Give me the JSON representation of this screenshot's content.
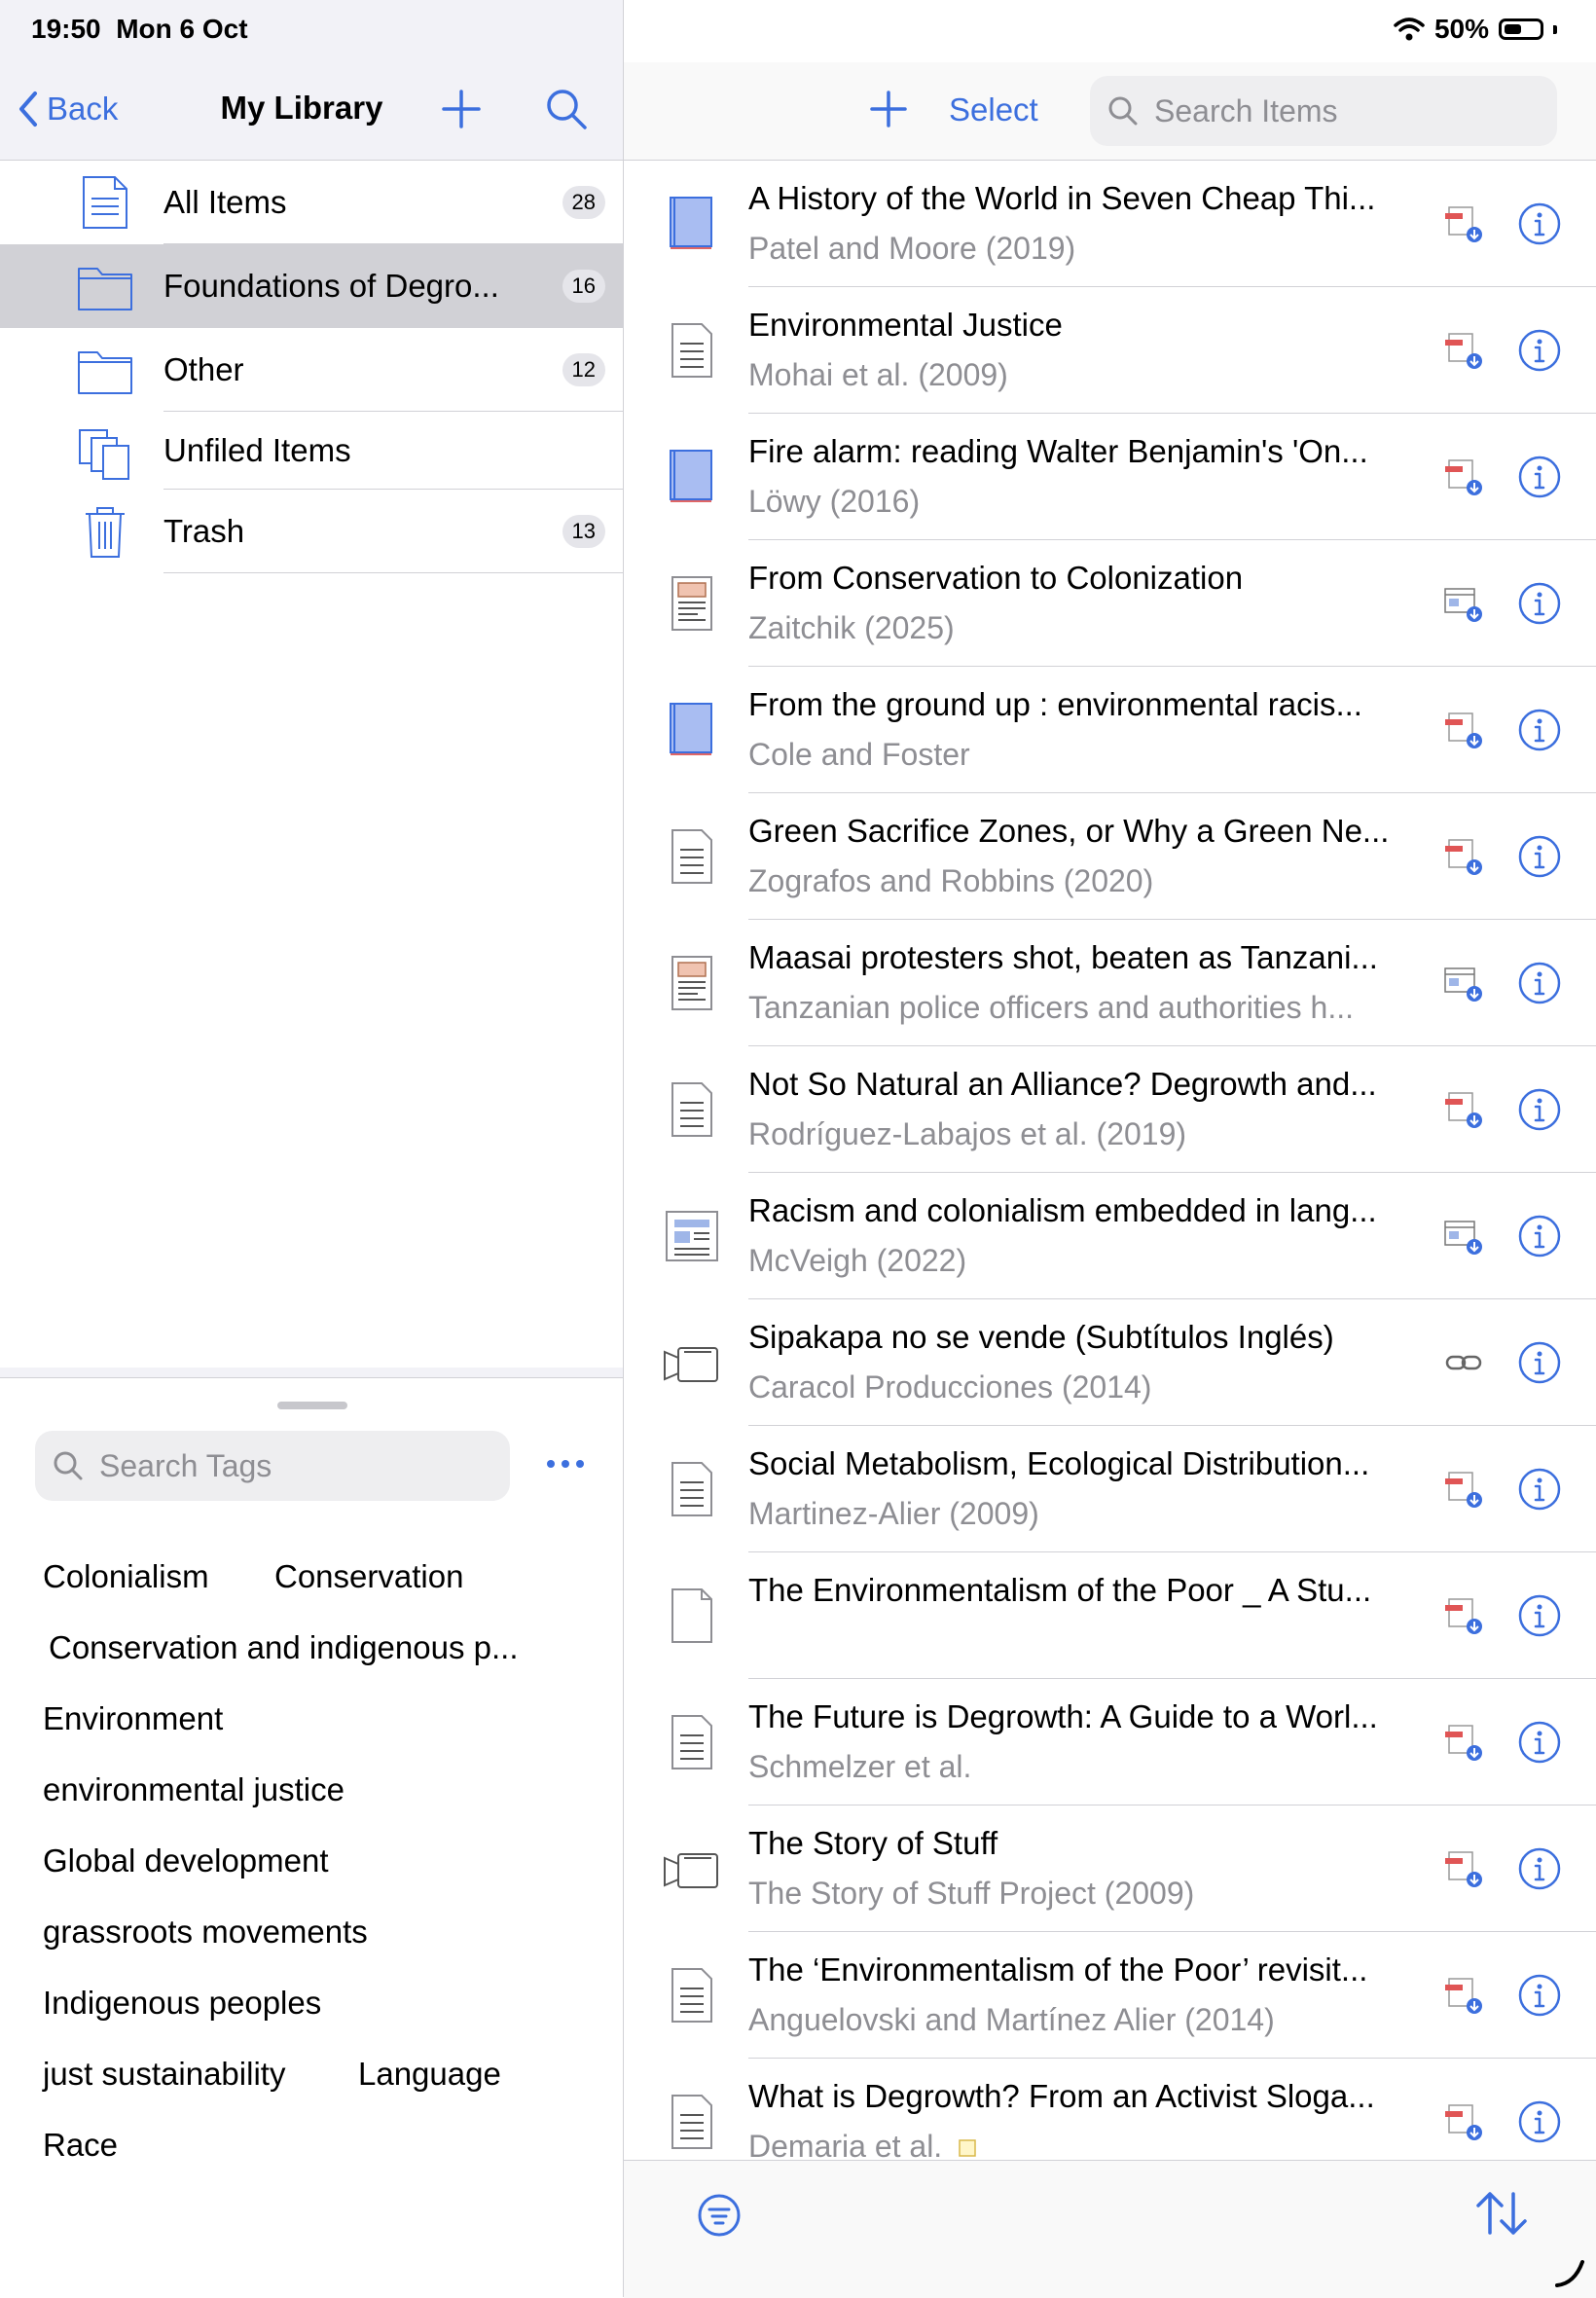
{
  "status": {
    "time": "19:50",
    "date": "Mon 6 Oct",
    "battery": "50%",
    "battery_level": 0.5
  },
  "left_header": {
    "back_label": "Back",
    "title": "My Library"
  },
  "collections": [
    {
      "label": "All Items",
      "count": "28",
      "icon": "document-icon"
    },
    {
      "label": "Foundations of Degro...",
      "count": "16",
      "icon": "folder-icon",
      "selected": true
    },
    {
      "label": "Other",
      "count": "12",
      "icon": "folder-icon"
    },
    {
      "label": "Unfiled Items",
      "count": "",
      "icon": "unfiled-icon"
    },
    {
      "label": "Trash",
      "count": "13",
      "icon": "trash-icon"
    }
  ],
  "tags": {
    "search_placeholder": "Search Tags",
    "items": [
      "Colonialism",
      "Conservation",
      "Conservation and indigenous p...",
      "Environment",
      "environmental justice",
      "Global development",
      "grassroots movements",
      "Indigenous peoples",
      "just sustainability",
      "Language",
      "Race"
    ]
  },
  "right_header": {
    "select_label": "Select",
    "search_placeholder": "Search Items"
  },
  "items": [
    {
      "title": "A History of the World in Seven Cheap Thi...",
      "subtitle": "Patel and Moore (2019)",
      "type": "book",
      "attachment": "pdf"
    },
    {
      "title": "Environmental Justice",
      "subtitle": "Mohai et al. (2009)",
      "type": "article",
      "attachment": "pdf"
    },
    {
      "title": "Fire alarm: reading Walter Benjamin's 'On...",
      "subtitle": "Löwy (2016)",
      "type": "book",
      "attachment": "pdf"
    },
    {
      "title": "From Conservation to Colonization",
      "subtitle": "Zaitchik (2025)",
      "type": "magazine",
      "attachment": "snapshot"
    },
    {
      "title": "From the ground up : environmental racis...",
      "subtitle": "Cole and Foster",
      "type": "book",
      "attachment": "pdf"
    },
    {
      "title": "Green Sacrifice Zones, or Why a Green Ne...",
      "subtitle": "Zografos and Robbins (2020)",
      "type": "article",
      "attachment": "pdf"
    },
    {
      "title": "Maasai protesters shot, beaten as Tanzani...",
      "subtitle": "Tanzanian police officers and authorities h...",
      "type": "magazine",
      "attachment": "snapshot"
    },
    {
      "title": "Not So Natural an Alliance? Degrowth and...",
      "subtitle": "Rodríguez-Labajos et al. (2019)",
      "type": "article",
      "attachment": "pdf"
    },
    {
      "title": "Racism and colonialism embedded in lang...",
      "subtitle": "McVeigh (2022)",
      "type": "newspaper",
      "attachment": "snapshot"
    },
    {
      "title": "Sipakapa no se vende (Subtítulos Inglés)",
      "subtitle": "Caracol Producciones (2014)",
      "type": "video",
      "attachment": "link"
    },
    {
      "title": "Social Metabolism, Ecological Distribution...",
      "subtitle": "Martinez-Alier (2009)",
      "type": "article",
      "attachment": "pdf"
    },
    {
      "title": "The Environmentalism of the Poor _ A Stu...",
      "subtitle": "",
      "type": "blank",
      "attachment": "pdf"
    },
    {
      "title": "The Future is Degrowth: A Guide to a Worl...",
      "subtitle": "Schmelzer et al.",
      "type": "article",
      "attachment": "pdf"
    },
    {
      "title": "The Story of Stuff",
      "subtitle": "The Story of Stuff Project (2009)",
      "type": "video",
      "attachment": "pdf"
    },
    {
      "title": "The ‘Environmentalism of the Poor’ revisit...",
      "subtitle": "Anguelovski and Martínez Alier (2014)",
      "type": "article",
      "attachment": "pdf"
    },
    {
      "title": "What is Degrowth? From an Activist Sloga...",
      "subtitle": "Demaria et al.",
      "type": "article",
      "attachment": "pdf",
      "note": true
    }
  ],
  "colors": {
    "accent": "#3c6fde",
    "selected_bg": "#d1d1d6",
    "secondary_text": "#8e8e93"
  }
}
